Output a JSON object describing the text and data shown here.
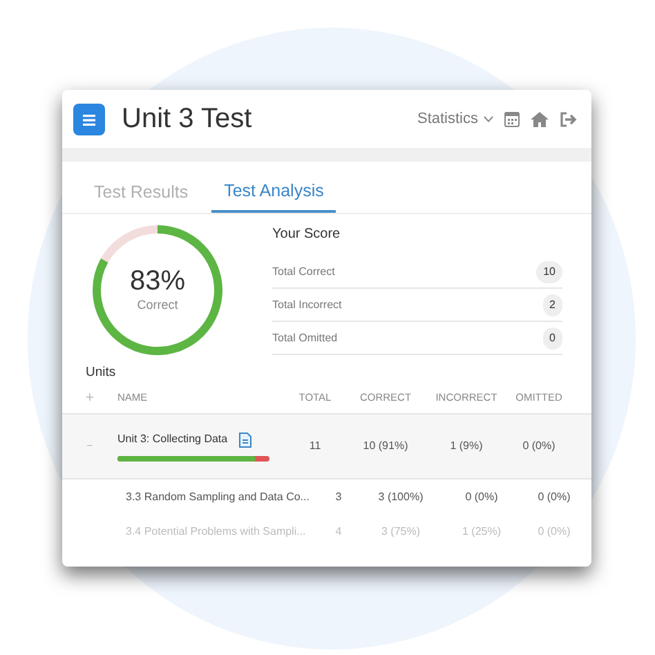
{
  "header": {
    "title": "Unit 3 Test",
    "menu": "Statistics"
  },
  "tabs": [
    {
      "label": "Test Results",
      "selected": false
    },
    {
      "label": "Test Analysis",
      "selected": true
    }
  ],
  "score": {
    "percent": "83%",
    "caption": "Correct",
    "level": 0.83,
    "title": "Your Score",
    "rows": [
      {
        "label": "Total Correct",
        "value": "10"
      },
      {
        "label": "Total Incorrect",
        "value": "2"
      },
      {
        "label": "Total Omitted",
        "value": "0"
      }
    ]
  },
  "units": {
    "title": "Units",
    "expand_symbol": "+",
    "columns": [
      "NAME",
      "TOTAL",
      "CORRECT",
      "INCORRECT",
      "OMITTED"
    ],
    "rows": [
      {
        "kind": "unit",
        "toggle": "−",
        "name": "Unit 3: Collecting Data",
        "level": 0.91,
        "total": "11",
        "correct": "10 (91%)",
        "incorrect": "1 (9%)",
        "omitted": "0 (0%)"
      },
      {
        "kind": "lesson",
        "faded": false,
        "name": "3.3 Random Sampling and Data Co...",
        "total": "3",
        "correct": "3 (100%)",
        "incorrect": "0 (0%)",
        "omitted": "0 (0%)"
      },
      {
        "kind": "lesson",
        "faded": true,
        "name": "3.4 Potential Problems with Sampli...",
        "total": "4",
        "correct": "3 (75%)",
        "incorrect": "1 (25%)",
        "omitted": "0 (0%)"
      }
    ]
  }
}
